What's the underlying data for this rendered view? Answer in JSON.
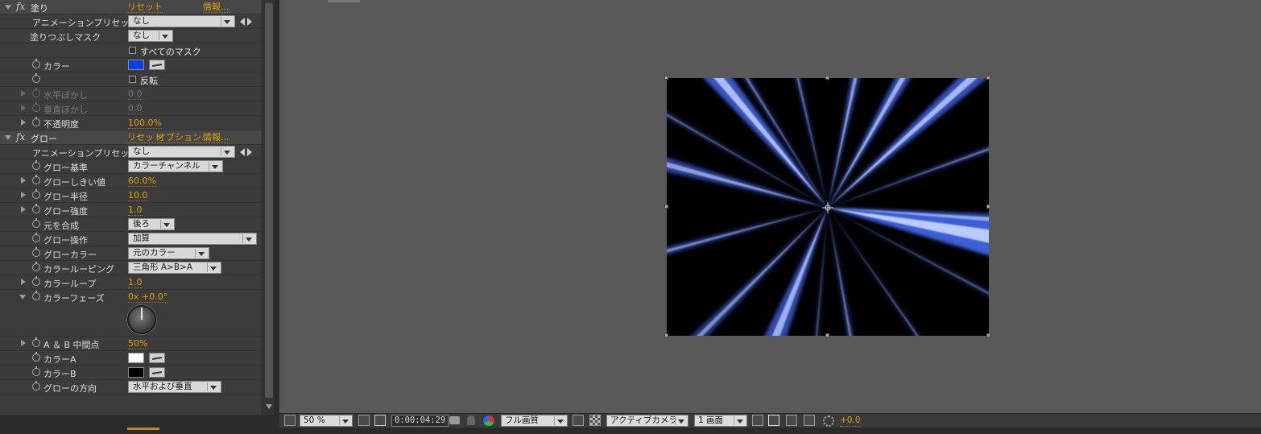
{
  "effect_controls": {
    "fill": {
      "name": "塗り",
      "reset": "リセット",
      "about": "情報...",
      "preset_label": "アニメーションプリセット :",
      "preset_value": "なし",
      "mask_label": "塗りつぶしマスク",
      "mask_value": "なし",
      "all_masks": "すべてのマスク",
      "color_label": "カラー",
      "color": "#0a3ee8",
      "invert": "反転",
      "h_feather_label": "水平ぼかし",
      "h_feather_value": "0.0",
      "v_feather_label": "垂直ぼかし",
      "v_feather_value": "0.0",
      "opacity_label": "不透明度",
      "opacity_value": "100.0%"
    },
    "glow": {
      "name": "グロー",
      "reset": "リセット",
      "options": "オプション...",
      "about": "情報...",
      "preset_label": "アニメーションプリセット :",
      "preset_value": "なし",
      "based_on_label": "グロー基準",
      "based_on_value": "カラーチャンネル",
      "threshold_label": "グローしきい値",
      "threshold_value": "60.0%",
      "radius_label": "グロー半径",
      "radius_value": "10.0",
      "intensity_label": "グロー強度",
      "intensity_value": "1.0",
      "composite_label": "元を合成",
      "composite_value": "後ろ",
      "operation_label": "グロー操作",
      "operation_value": "加算",
      "colors_label": "グローカラー",
      "colors_value": "元のカラー",
      "looping_label": "カラールーピング",
      "looping_value": "三角形 A>B>A",
      "loops_label": "カラーループ",
      "loops_value": "1.0",
      "phase_label": "カラーフェーズ",
      "phase_value": "0x +0.0°",
      "midpoint_label": "A ＆ B 中間点",
      "midpoint_value": "50%",
      "color_a_label": "カラーA",
      "color_a": "#ffffff",
      "color_b_label": "カラーB",
      "color_b": "#000000",
      "dimensions_label": "グローの方向",
      "dimensions_value": "水平および垂直"
    }
  },
  "viewer": {
    "magnification": "50 %",
    "timecode": "0:00:04:29",
    "resolution": "フル画質",
    "camera": "アクティブカメラ",
    "views": "1 画面",
    "exposure": "+0.0"
  }
}
